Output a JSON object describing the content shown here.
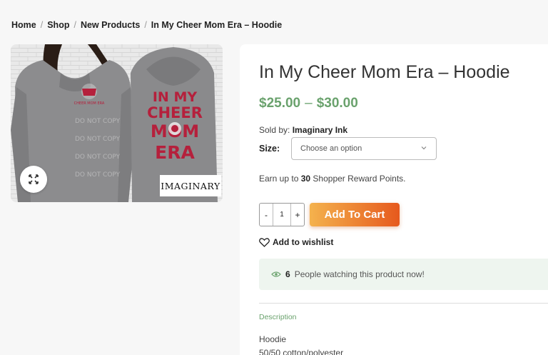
{
  "breadcrumb": {
    "home": "Home",
    "shop": "Shop",
    "category": "New Products",
    "current": "In My Cheer Mom Era – Hoodie",
    "separator": "/"
  },
  "gallery": {
    "hoodie_print": [
      "IN MY",
      "CHEER",
      "MOM",
      "ERA"
    ],
    "watermark": "DO NOT COPY",
    "brand_badge": "IMAGINARY",
    "zoom_icon": "expand-arrows-icon"
  },
  "product": {
    "title": "In My Cheer Mom Era – Hoodie",
    "price_min": "$25.00",
    "price_dash": "–",
    "price_max": "$30.00",
    "sold_by_label": "Sold by:",
    "seller": "Imaginary Ink",
    "size_label": "Size",
    "size_colon": ":",
    "size_placeholder": "Choose an option",
    "points_prefix": "Earn up to",
    "points_value": "30",
    "points_suffix": "Shopper Reward Points.",
    "qty_minus": "-",
    "qty_value": "1",
    "qty_plus": "+",
    "add_to_cart": "Add To Cart",
    "wishlist": "Add to wishlist",
    "watching_count": "6",
    "watching_text": "People watching this product now!",
    "description_tab": "Description",
    "description_lines": [
      "Hoodie",
      "50/50 cotton/polyester"
    ]
  },
  "colors": {
    "price_green": "#6aa26d",
    "cart_gradient_start": "#f4b24d",
    "cart_gradient_end": "#e6591d",
    "print_red": "#b5203c",
    "hoodie_grey": "#8c8c8e"
  }
}
